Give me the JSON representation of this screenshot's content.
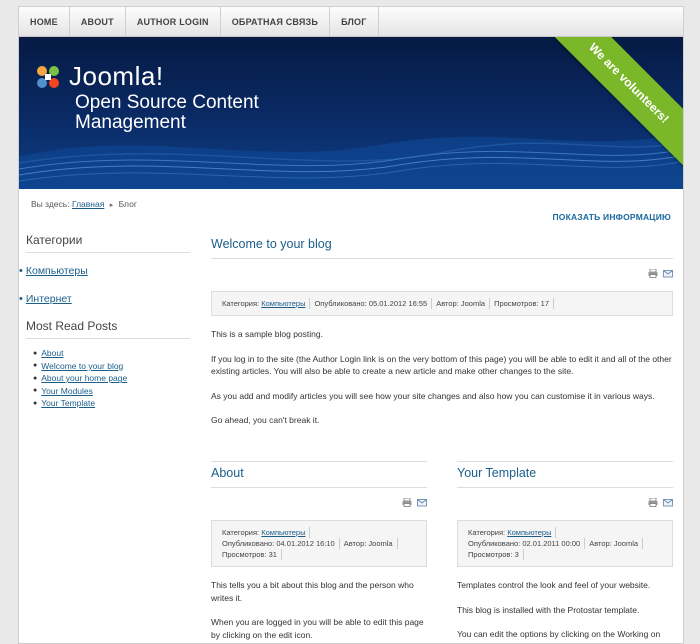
{
  "nav": {
    "items": [
      "HOME",
      "ABOUT",
      "AUTHOR LOGIN",
      "ОБРАТНАЯ СВЯЗЬ",
      "БЛОГ"
    ]
  },
  "banner": {
    "logo_text": "Joomla!",
    "tagline": "Open Source Content Management",
    "ribbon": "We are volunteers!"
  },
  "breadcrumb": {
    "prefix": "Вы здесь:",
    "home": "Главная",
    "current": "Блог"
  },
  "show_info": "ПОКАЗАТЬ ИНФОРМАЦИЮ",
  "sidebar": {
    "categories_title": "Категории",
    "categories": [
      "Компьютеры",
      "Интернет"
    ],
    "most_read_title": "Most Read Posts",
    "most_read": [
      "About",
      "Welcome to your blog",
      "About your home page",
      "Your Modules",
      "Your Template"
    ]
  },
  "main_article": {
    "title": "Welcome to your blog",
    "info": {
      "category_label": "Категория:",
      "category": "Компьютеры",
      "published": "Опубликовано: 05.01.2012 16:55",
      "author": "Автор: Joomla",
      "views": "Просмотров: 17"
    },
    "paragraphs": [
      "This is a sample blog posting.",
      "If you log in to the site (the Author Login link is on the very bottom of this page) you will be able to edit it and all of the other existing articles. You will also be able to create a new article and make other changes to the site.",
      "As you add and modify articles you will see how your site changes and also how you can customise it in various ways.",
      "Go ahead, you can't break it."
    ]
  },
  "about_article": {
    "title": "About",
    "info": {
      "category_label": "Категория:",
      "category": "Компьютеры",
      "published": "Опубликовано: 04.01.2012 16:10",
      "author": "Автор: Joomla",
      "views": "Просмотров: 31"
    },
    "paragraphs": [
      "This tells you a bit about this blog and the person who writes it.",
      "When you are logged in you will be able to edit this page by clicking on the edit icon."
    ]
  },
  "template_article": {
    "title": "Your Template",
    "info": {
      "category_label": "Категория:",
      "category": "Компьютеры",
      "published": "Опубликовано: 02.01.2011 00:00",
      "author": "Автор: Joomla",
      "views": "Просмотров: 3"
    },
    "paragraphs": [
      "Templates control the look and feel of your website.",
      "This blog is installed with the Protostar template.",
      "You can edit the options by clicking on the Working on Your Site, Template Settings link in the top menu (visible when you"
    ]
  },
  "colors": {
    "link": "#1b5e8c",
    "banner_dark": "#061a43",
    "ribbon": "#7ab829"
  }
}
